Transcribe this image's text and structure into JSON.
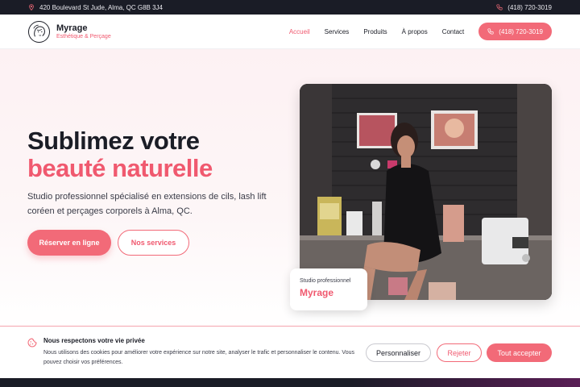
{
  "topbar": {
    "address": "420 Boulevard St Jude, Alma, QC G8B 3J4",
    "phone": "(418) 720-3019"
  },
  "header": {
    "brand_name": "Myrage",
    "brand_tagline": "Esthétique & Perçage",
    "nav": [
      "Accueil",
      "Services",
      "Produits",
      "À propos",
      "Contact"
    ],
    "active_nav": "Accueil",
    "call_button": "(418) 720-3019"
  },
  "hero": {
    "title_line1": "Sublimez votre",
    "title_line2": "beauté naturelle",
    "subtitle": "Studio professionnel spécialisé en extensions de cils, lash lift coréen et perçages corporels à Alma, QC.",
    "primary_button": "Réserver en ligne",
    "secondary_button": "Nos services",
    "card_small": "Studio professionnel",
    "card_big": "Myrage"
  },
  "cookie": {
    "title": "Nous respectons votre vie privée",
    "body": "Nous utilisons des cookies pour améliorer votre expérience sur notre site, analyser le trafic et personnaliser le contenu. Vous pouvez choisir vos préférences.",
    "customize": "Personnaliser",
    "reject": "Rejeter",
    "accept": "Tout accepter"
  },
  "colors": {
    "accent": "#f26a78",
    "dark": "#1a1c26"
  }
}
